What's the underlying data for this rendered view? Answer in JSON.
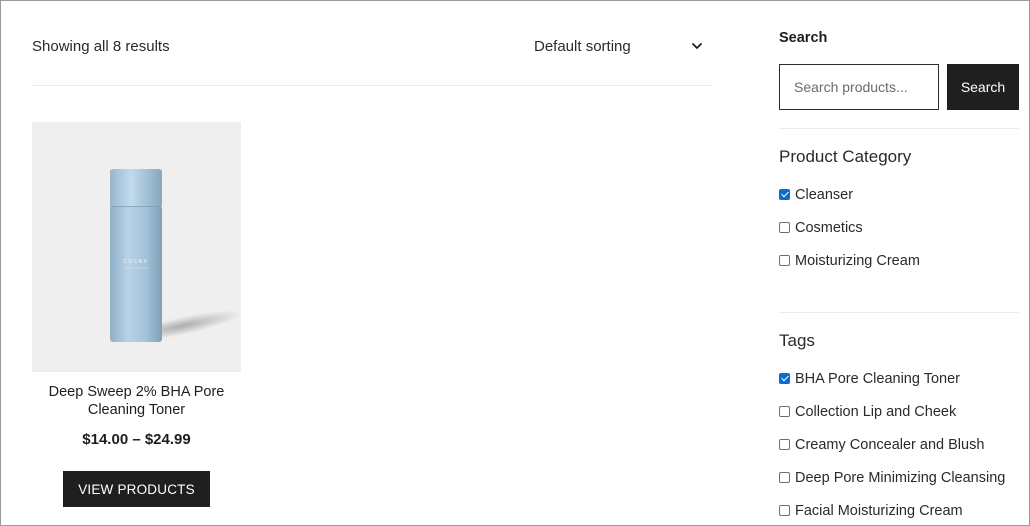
{
  "results": {
    "count_text": "Showing all 8 results",
    "sorting_label": "Default sorting",
    "sorting_icon": "chevron-down-icon"
  },
  "product": {
    "title": "Deep Sweep 2% BHA Pore Cleaning Toner",
    "price": "$14.00 – $24.99",
    "button_label": "VIEW PRODUCTS",
    "bottle_text": "COSRX"
  },
  "search": {
    "title": "Search",
    "placeholder": "Search products...",
    "button_label": "Search"
  },
  "categories": {
    "title": "Product Category",
    "items": [
      {
        "label": "Cleanser",
        "checked": true
      },
      {
        "label": "Cosmetics",
        "checked": false
      },
      {
        "label": "Moisturizing Cream",
        "checked": false
      }
    ]
  },
  "tags": {
    "title": "Tags",
    "items": [
      {
        "label": "BHA Pore Cleaning Toner",
        "checked": true
      },
      {
        "label": "Collection Lip and Cheek",
        "checked": false
      },
      {
        "label": "Creamy Concealer and Blush",
        "checked": false
      },
      {
        "label": "Deep Pore Minimizing Cleansing",
        "checked": false
      },
      {
        "label": "Facial Moisturizing Cream",
        "checked": false
      }
    ]
  },
  "colors": {
    "button_bg": "#1f1f1f",
    "checkbox_checked": "#0b6ecf",
    "bottle": "#a9c6dc"
  }
}
